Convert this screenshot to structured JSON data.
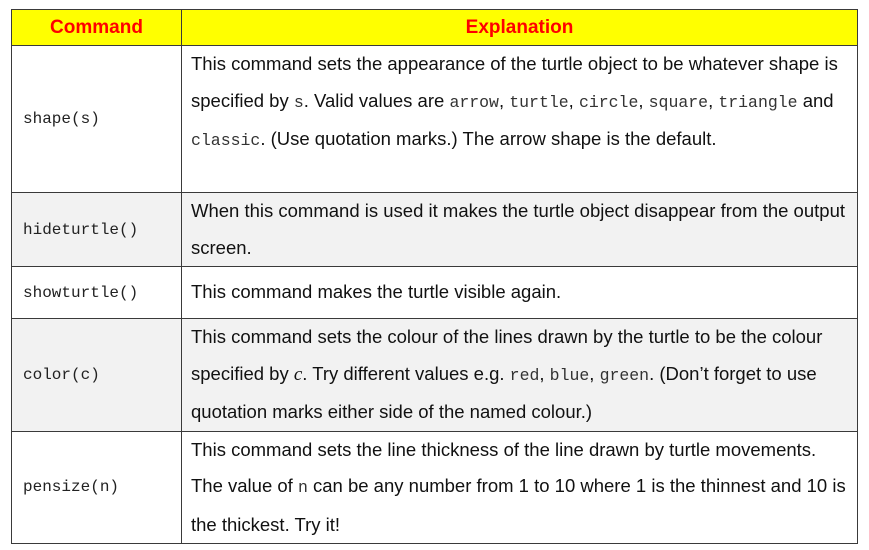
{
  "headers": {
    "command": "Command",
    "explanation": "Explanation"
  },
  "rows": [
    {
      "command": "shape(s)",
      "parts": [
        "This command sets the appearance of the turtle object to be whatever shape is specified by ",
        "s",
        ". Valid values are ",
        "arrow",
        ", ",
        "turtle",
        ", ",
        "circle",
        ", ",
        "square",
        ", ",
        "triangle",
        " and ",
        "classic",
        ". (Use quotation marks.) The arrow shape is the default."
      ]
    },
    {
      "command": "hideturtle()",
      "text": "When this command is used it makes the turtle object disappear from the output screen."
    },
    {
      "command": "showturtle()",
      "text": "This command makes the turtle visible again."
    },
    {
      "command": "color(c)",
      "parts": [
        "This command sets the colour of the lines drawn by the turtle to be the colour specified by ",
        "c",
        ". Try different values e.g. ",
        "red",
        ", ",
        "blue",
        ", ",
        "green",
        ". (Don’t forget to use quotation marks either side of the named colour.)"
      ]
    },
    {
      "command": "pensize(n)",
      "parts": [
        "This command sets the line thickness of the line drawn by turtle movements. The value of ",
        "n",
        " can be any number from 1 to 10 where 1 is the thinnest and 10 is the thickest. Try it!"
      ]
    }
  ],
  "colors": {
    "header_bg": "#ffff00",
    "header_text": "#ff0000",
    "alt_row_bg": "#f2f2f2"
  }
}
